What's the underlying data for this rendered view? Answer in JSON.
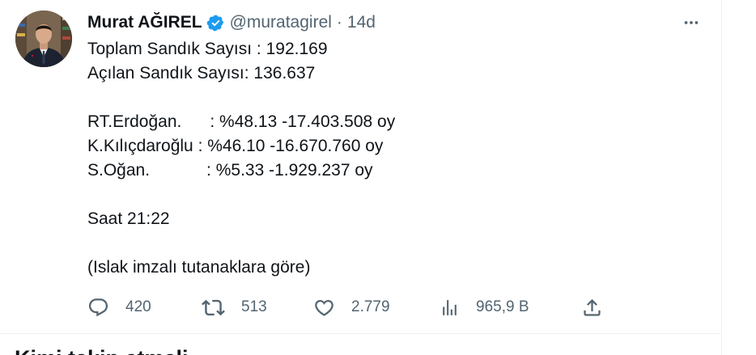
{
  "colors": {
    "text_primary": "#0f1419",
    "text_secondary": "#536471",
    "verified_blue": "#1d9bf0",
    "divider": "#eff3f4"
  },
  "tweet": {
    "author": {
      "name": "Murat AĞIREL",
      "handle": "@muratagirel",
      "verified": true,
      "avatar_icon": "user-avatar-photo"
    },
    "separator": "·",
    "time": "14d",
    "more_icon": "more-horizontal-icon",
    "text": "Toplam Sandık Sayısı : 192.169\nAçılan Sandık Sayısı: 136.637\n\nRT.Erdoğan.      : %48.13 -17.403.508 oy\nK.Kılıçdaroğlu : %46.10 -16.670.760 oy\nS.Oğan.            : %5.33 -1.929.237 oy\n\nSaat 21:22\n\n(Islak imzalı tutanaklara göre)",
    "actions": {
      "replies": "420",
      "retweets": "513",
      "likes": "2.779",
      "views": "965,9 B"
    }
  },
  "next_section": {
    "heading": "Kimi takip etmeli"
  }
}
